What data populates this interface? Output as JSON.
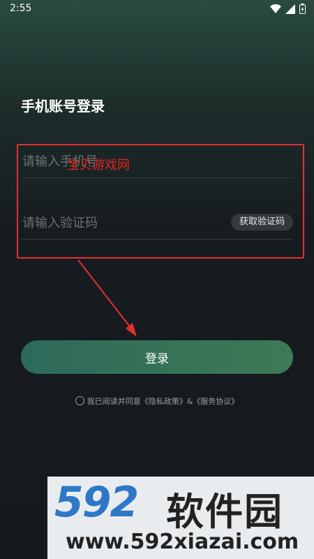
{
  "status_bar": {
    "time": "2:55",
    "icons": [
      "wifi-icon",
      "signal-icon",
      "battery-icon"
    ]
  },
  "login": {
    "title": "手机账号登录",
    "phone_placeholder": "请输入手机号",
    "code_placeholder": "请输入验证码",
    "get_code_label": "获取验证码",
    "login_label": "登录",
    "agreement_prefix": "我已阅读并同意",
    "privacy_link": "《隐私政策》",
    "ampersand": "&",
    "terms_link": "《服务协议》"
  },
  "annotation": {
    "watermark_text": "宝贝游戏网",
    "color": "#e53030"
  },
  "watermark_banner": {
    "logo_digits": "592",
    "logo_cn": "软件园",
    "url": "www.592xiazai.com"
  }
}
